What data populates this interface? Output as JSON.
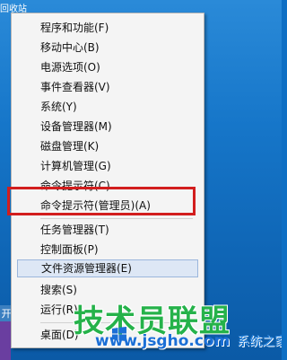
{
  "desktop": {
    "top_icon_label": "回收站",
    "start_label": "开"
  },
  "menu": {
    "items": [
      {
        "label": "程序和功能(F)"
      },
      {
        "label": "移动中心(B)"
      },
      {
        "label": "电源选项(O)"
      },
      {
        "label": "事件查看器(V)"
      },
      {
        "label": "系统(Y)"
      },
      {
        "label": "设备管理器(M)"
      },
      {
        "label": "磁盘管理(K)"
      },
      {
        "label": "计算机管理(G)"
      },
      {
        "label": "命令提示符(C)"
      },
      {
        "label": "命令提示符(管理员)(A)"
      },
      {
        "label": "任务管理器(T)"
      },
      {
        "label": "控制面板(P)"
      },
      {
        "label": "文件资源管理器(E)"
      },
      {
        "label": "搜索(S)"
      },
      {
        "label": "运行(R)"
      },
      {
        "label": "桌面(D)"
      }
    ]
  },
  "watermark": {
    "title": "技术员联盟",
    "url": "www.jsgho.com",
    "suffix": "系统之家"
  },
  "colors": {
    "highlight_border": "#d21e1e",
    "hover_bg": "#dde7f5",
    "menu_bg": "#f4f4f4"
  }
}
